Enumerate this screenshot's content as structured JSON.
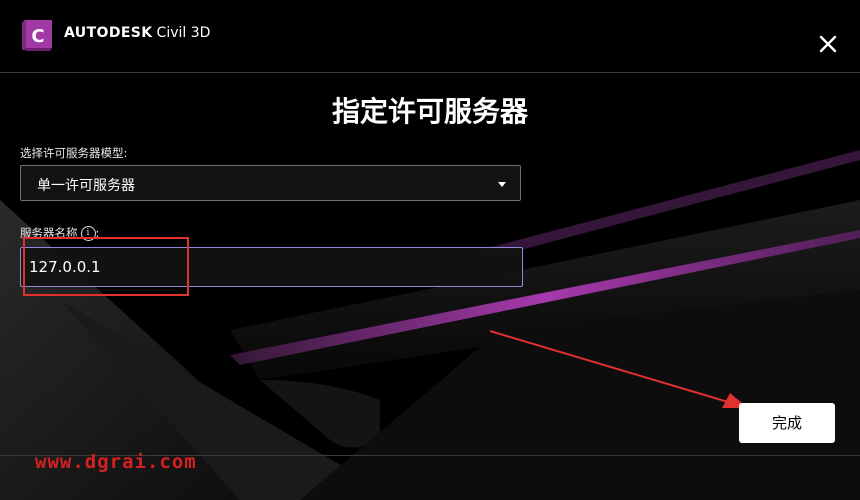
{
  "header": {
    "logo_letter": "C",
    "brand": "AUTODESK",
    "product": "Civil 3D",
    "close_icon": "close-icon"
  },
  "dialog": {
    "title": "指定许可服务器",
    "model_label": "选择许可服务器模型:",
    "model_value": "单一许可服务器",
    "server_label": "服务器名称",
    "server_label_suffix": ":",
    "info_glyph": "i",
    "server_value": "127.0.0.1",
    "finish_label": "完成"
  },
  "watermark": "www.dgrai.com",
  "colors": {
    "background": "#000000",
    "accent_magenta": "#c040c8",
    "logo_purple": "#a23aa6",
    "annotation_red": "#e03030",
    "input_focus": "#8b8bdc"
  }
}
